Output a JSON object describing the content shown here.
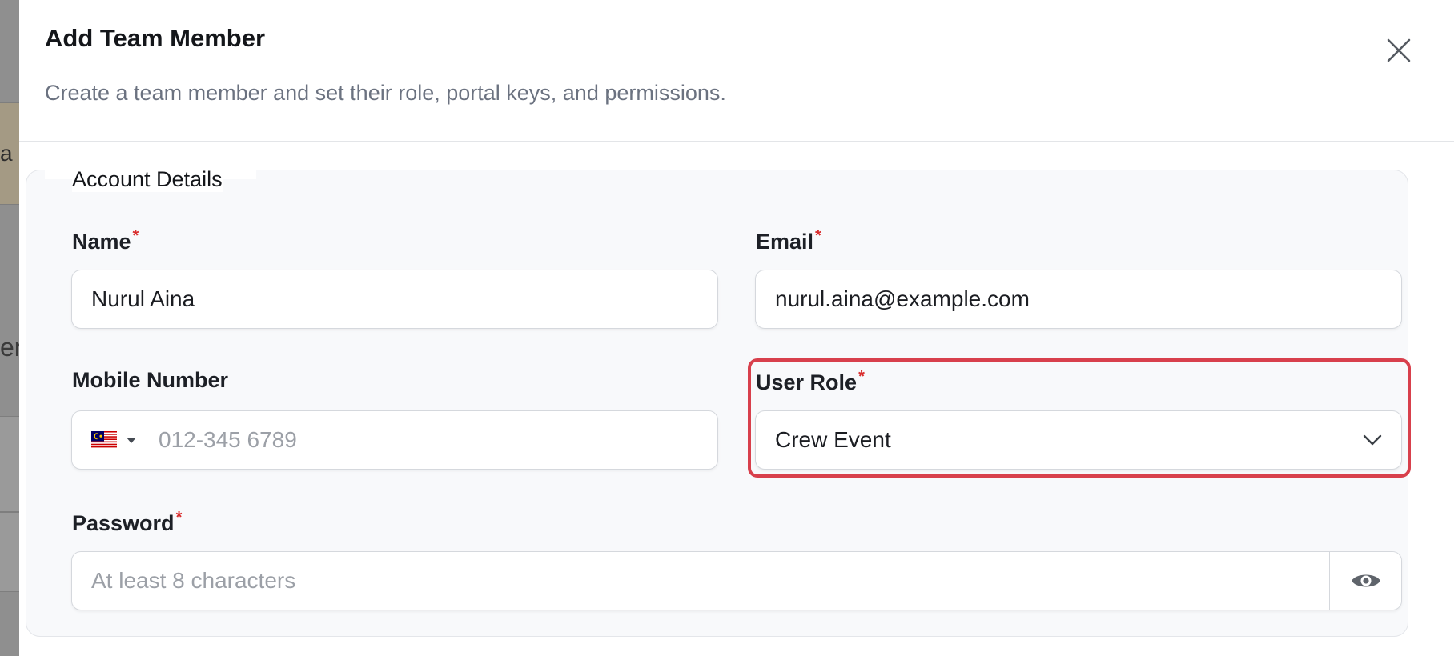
{
  "background_fragments": [
    "a",
    "er"
  ],
  "modal": {
    "title": "Add Team Member",
    "subtitle": "Create a team member and set their role, portal keys, and permissions.",
    "close_icon": "close-icon"
  },
  "section": {
    "legend": "Account Details"
  },
  "fields": {
    "name": {
      "label": "Name",
      "required_mark": "*",
      "value": "Nurul Aina"
    },
    "email": {
      "label": "Email",
      "required_mark": "*",
      "value": "nurul.aina@example.com"
    },
    "mobile": {
      "label": "Mobile Number",
      "country_flag_icon": "malaysia-flag-icon",
      "placeholder": "012-345 6789"
    },
    "user_role": {
      "label": "User Role",
      "required_mark": "*",
      "selected": "Crew Event",
      "chevron_icon": "chevron-down-icon"
    },
    "password": {
      "label": "Password",
      "required_mark": "*",
      "placeholder": "At least 8 characters",
      "toggle_icon": "eye-icon"
    }
  },
  "colors": {
    "highlight": "#d8404c",
    "required": "#d92d2d",
    "section_bg": "#f8f9fb"
  }
}
